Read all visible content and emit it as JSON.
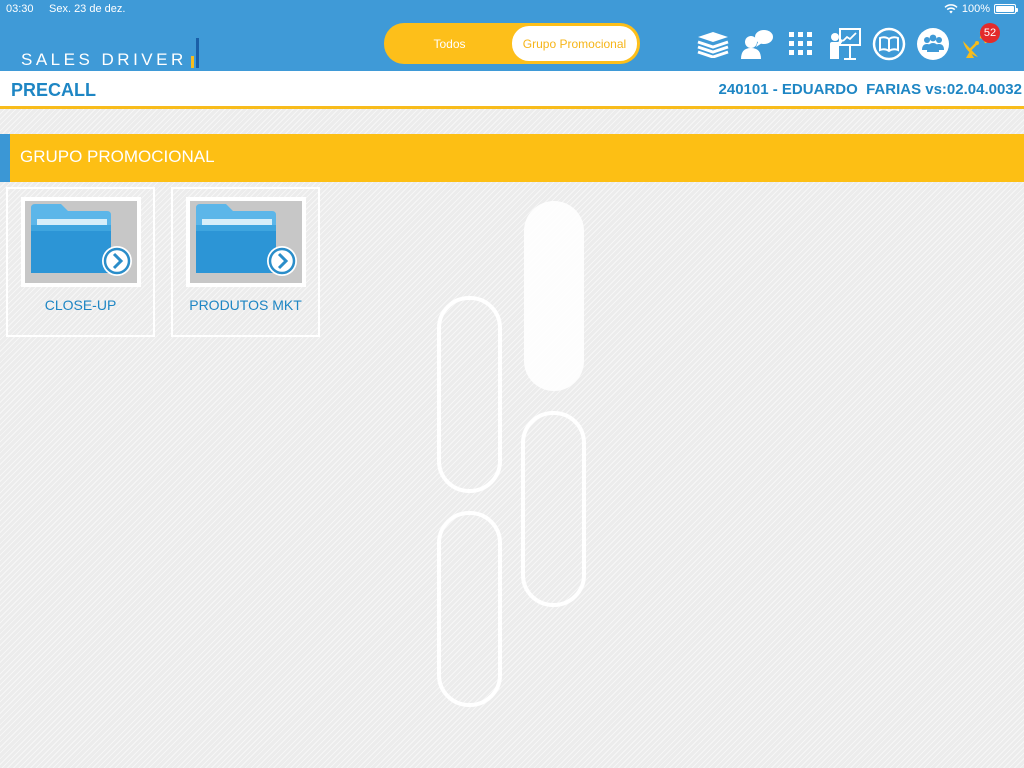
{
  "status": {
    "time": "03:30",
    "date": "Sex. 23 de dez.",
    "battery": "100%",
    "battery_level_percent": 100
  },
  "app": {
    "logo_text": "SALES DRIVER",
    "logo_colors": [
      "#f8bc1c",
      "#ffffff",
      "#1a5fa8"
    ]
  },
  "segmented": {
    "items": [
      "Todos",
      "Grupo Promocional"
    ],
    "selected": "Grupo Promocional"
  },
  "toolbar": {
    "icons": [
      "books-icon",
      "chat-user-icon",
      "grid-icon",
      "presentation-icon",
      "book-icon",
      "group-icon",
      "satellite-icon"
    ],
    "notifications_count": "52"
  },
  "header": {
    "title": "PRECALL",
    "user_info": "240101 - EDUARDO  FARIAS vs:02.04.0032"
  },
  "section": {
    "title": "GRUPO PROMOCIONAL"
  },
  "folders": [
    {
      "label": "CLOSE-UP",
      "icon": "folder-icon"
    },
    {
      "label": "PRODUTOS MKT",
      "icon": "folder-icon"
    }
  ],
  "colors": {
    "brand_blue": "#3f9ad7",
    "text_blue": "#1e86c4",
    "accent_yellow": "#fdbf14",
    "badge_red": "#e32b2b"
  }
}
